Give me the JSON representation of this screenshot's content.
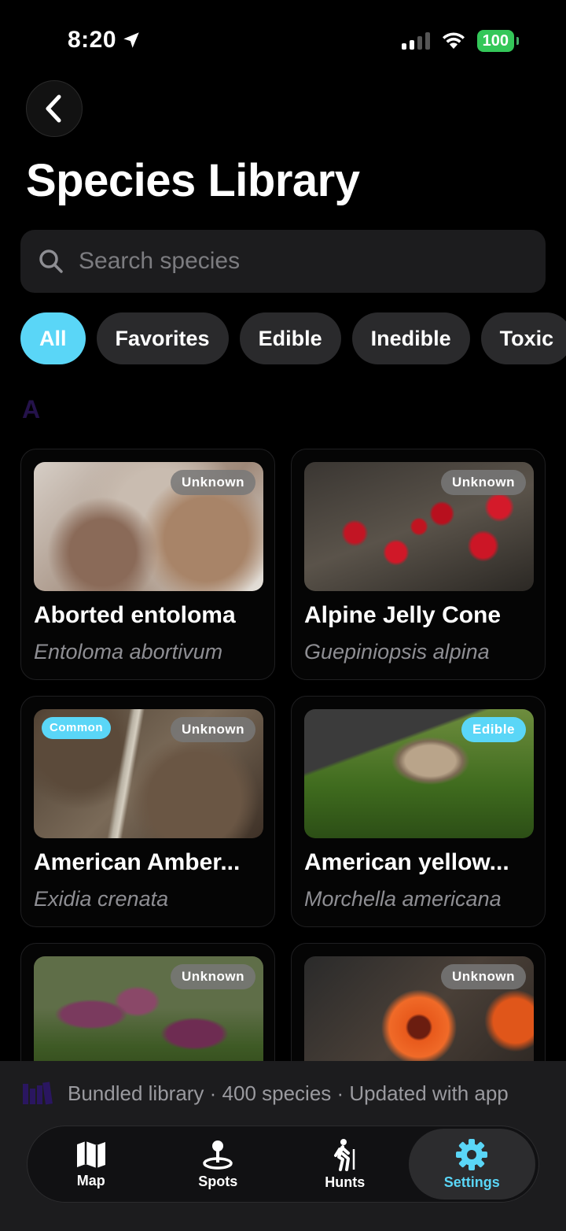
{
  "status": {
    "time": "8:20",
    "battery": "100"
  },
  "page": {
    "title": "Species Library"
  },
  "search": {
    "placeholder": "Search species"
  },
  "chips": [
    {
      "label": "All",
      "active": true
    },
    {
      "label": "Favorites"
    },
    {
      "label": "Edible"
    },
    {
      "label": "Inedible"
    },
    {
      "label": "Toxic"
    }
  ],
  "section": {
    "letter": "A"
  },
  "species": [
    {
      "name": "Aborted entoloma",
      "scientific": "Entoloma abortivum",
      "badge": "Unknown"
    },
    {
      "name": "Alpine Jelly Cone",
      "scientific": "Guepiniopsis alpina",
      "badge": "Unknown"
    },
    {
      "name": "American Amber...",
      "scientific": "Exidia crenata",
      "badge": "Unknown",
      "tag": "Common"
    },
    {
      "name": "American yellow...",
      "scientific": "Morchella americana",
      "badge": "Edible"
    },
    {
      "name": "",
      "scientific": "",
      "badge": "Unknown"
    },
    {
      "name": "",
      "scientific": "",
      "badge": "Unknown"
    }
  ],
  "info": {
    "text": "Bundled library · 400 species · Updated with app"
  },
  "tabs": [
    {
      "label": "Map",
      "icon": "map-icon"
    },
    {
      "label": "Spots",
      "icon": "pin-icon"
    },
    {
      "label": "Hunts",
      "icon": "hiker-icon"
    },
    {
      "label": "Settings",
      "icon": "gear-icon",
      "active": true
    }
  ],
  "colors": {
    "accent": "#5ad6f7",
    "background": "#000000",
    "battery": "#34c759"
  }
}
